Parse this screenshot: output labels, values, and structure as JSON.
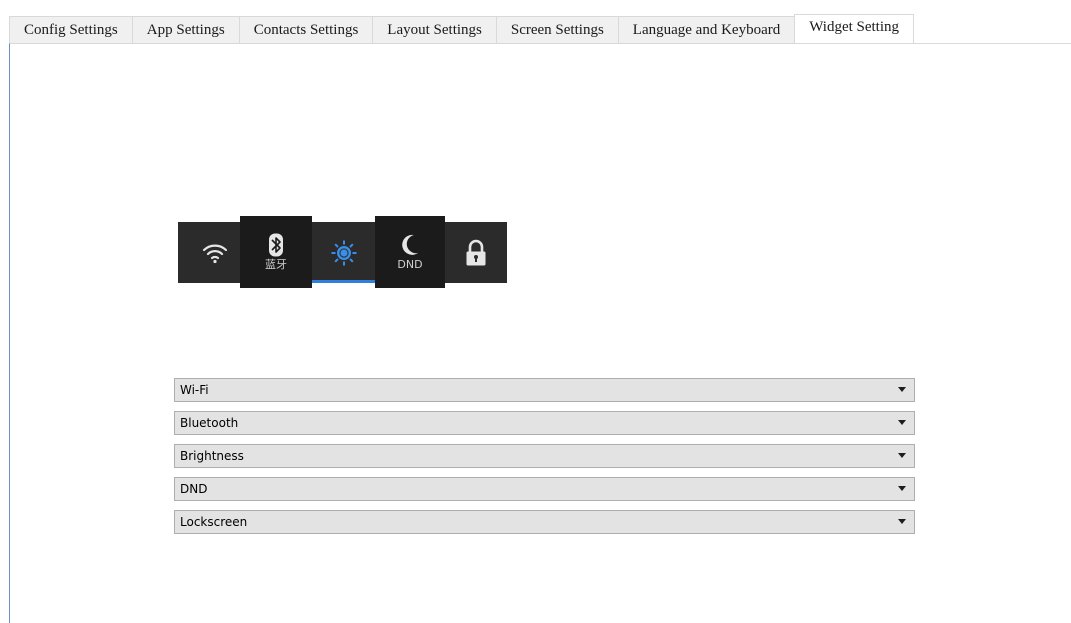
{
  "tabs": [
    {
      "label": "Config Settings"
    },
    {
      "label": "App Settings"
    },
    {
      "label": "Contacts Settings"
    },
    {
      "label": "Layout Settings"
    },
    {
      "label": "Screen Settings"
    },
    {
      "label": "Language and Keyboard"
    },
    {
      "label": "Widget Setting"
    }
  ],
  "active_tab": "Widget Setting",
  "preview": {
    "bluetooth_label": "蓝牙",
    "dnd_label": "DND",
    "colors": {
      "accent": "#2f7fdc",
      "bar": "#2b2b2b",
      "icon": "#e6e6e6"
    },
    "icons": [
      "wifi-icon",
      "bluetooth-icon",
      "brightness-icon",
      "moon-icon",
      "lock-icon"
    ]
  },
  "selects": [
    {
      "value": "Wi-Fi"
    },
    {
      "value": "Bluetooth"
    },
    {
      "value": "Brightness"
    },
    {
      "value": "DND"
    },
    {
      "value": "Lockscreen"
    }
  ]
}
